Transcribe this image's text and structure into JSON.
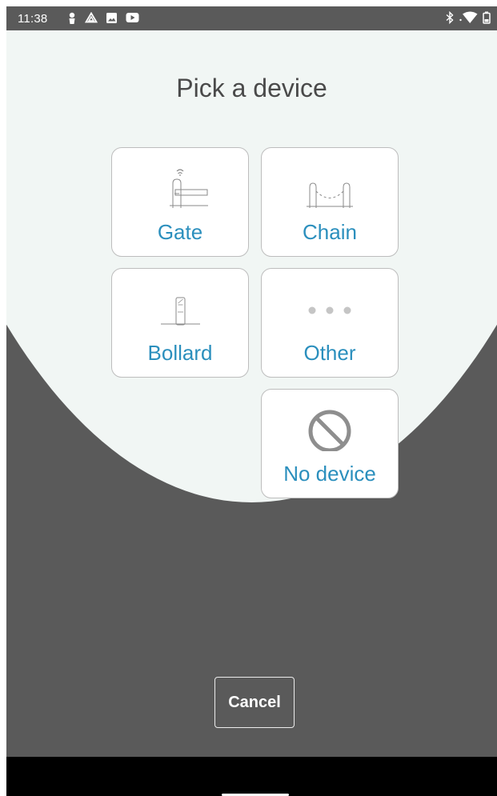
{
  "status_bar": {
    "time": "11:38",
    "left_icons": [
      "person-pin-icon",
      "drive-icon",
      "image-icon",
      "youtube-icon"
    ],
    "right_icons": [
      "bluetooth-icon",
      "wifi-icon",
      "battery-icon"
    ]
  },
  "page": {
    "title": "Pick a device"
  },
  "devices": [
    {
      "label": "Gate",
      "icon": "gate-icon"
    },
    {
      "label": "Chain",
      "icon": "chain-icon"
    },
    {
      "label": "Bollard",
      "icon": "bollard-icon"
    },
    {
      "label": "Other",
      "icon": "more-dots-icon"
    },
    {
      "label": "No device",
      "icon": "prohibited-icon"
    }
  ],
  "footer": {
    "cancel_label": "Cancel"
  },
  "colors": {
    "accent": "#2b8fbd",
    "light_background": "#f1f6f4",
    "dark_background": "#5a5a5a"
  }
}
